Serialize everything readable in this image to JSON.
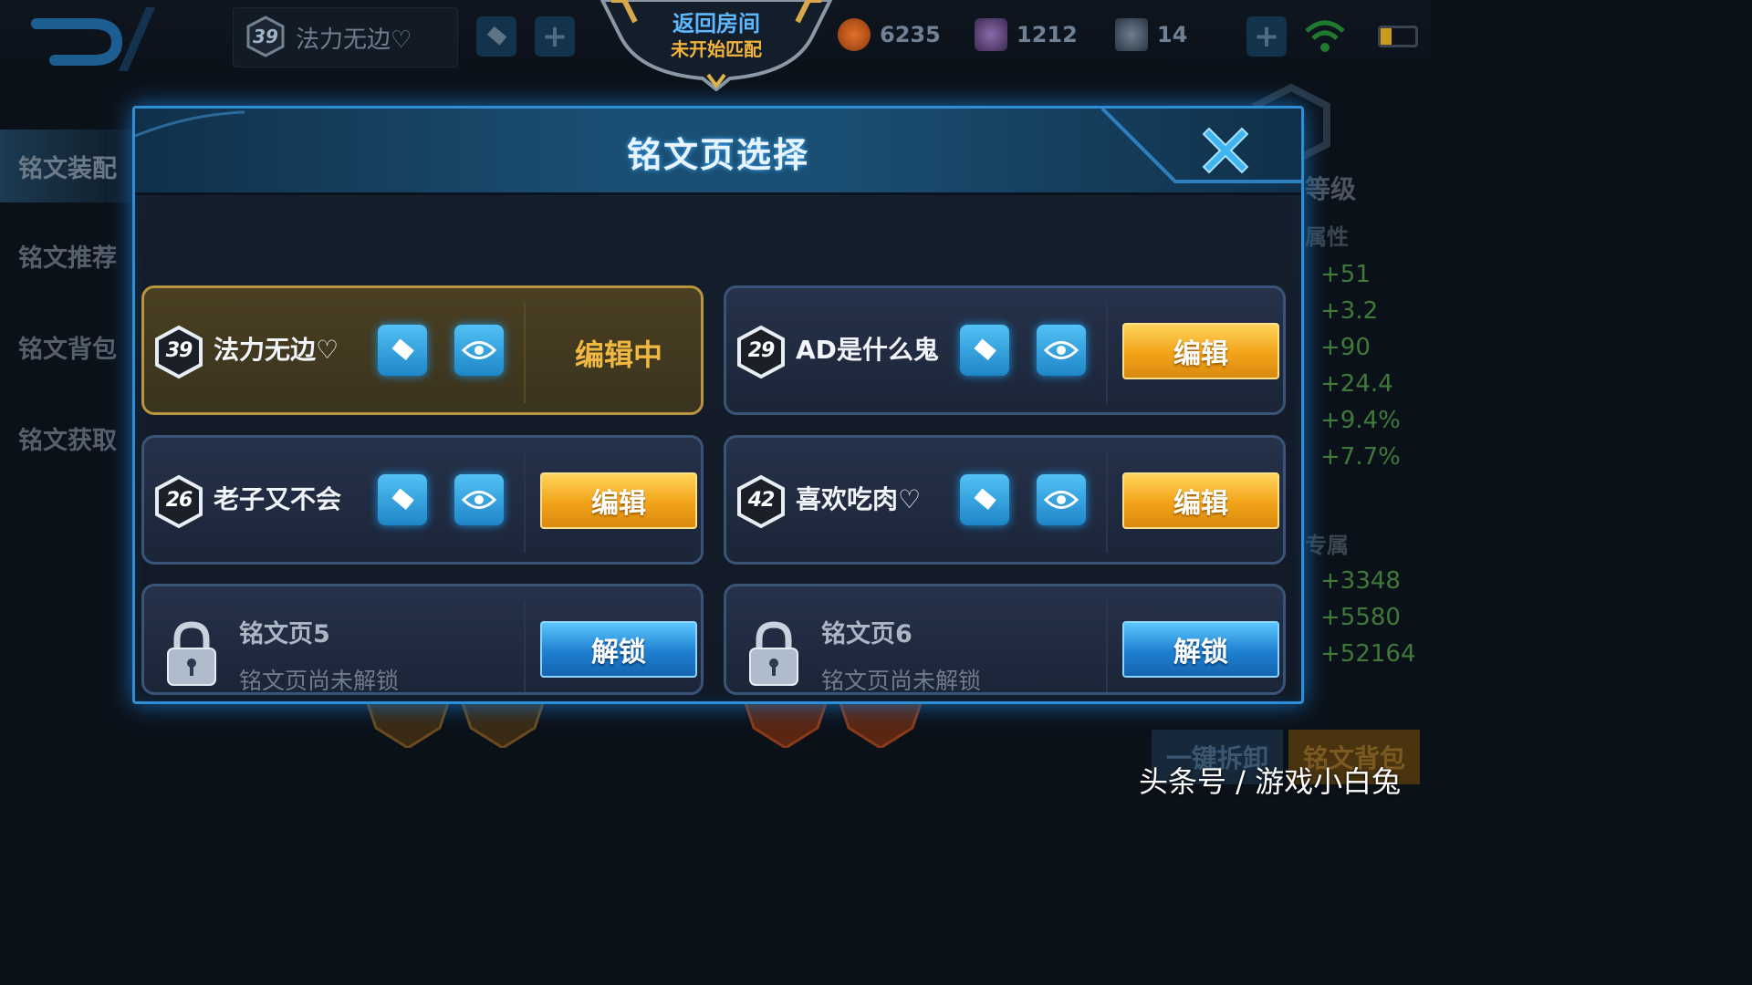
{
  "topbar": {
    "player_level": "39",
    "player_page_name": "法力无边♡",
    "room": {
      "title": "返回房间",
      "subtitle": "未开始匹配"
    },
    "resources": {
      "gold": "6235",
      "diamonds": "1212",
      "vouchers": "14"
    }
  },
  "sidebar": {
    "items": [
      {
        "label": "铭文装配"
      },
      {
        "label": "铭文推荐"
      },
      {
        "label": "铭文背包"
      },
      {
        "label": "铭文获取"
      }
    ]
  },
  "right_panel": {
    "level_label": "等级",
    "attr_label": "属性",
    "stats": [
      "+51",
      "+3.2",
      "+90",
      "+24.4",
      "+9.4%",
      "+7.7%"
    ],
    "exclusive_label": "专属",
    "exclusive_stats": [
      "+3348",
      "+5580",
      "+52164"
    ]
  },
  "bottom_buttons": {
    "disassemble": "一键拆卸",
    "bag": "铭文背包"
  },
  "modal": {
    "title": "铭文页选择",
    "pages": [
      {
        "level": "39",
        "name": "法力无边♡",
        "state": "编辑中"
      },
      {
        "level": "29",
        "name": "AD是什么鬼",
        "action": "编辑"
      },
      {
        "level": "26",
        "name": "老子又不会",
        "action": "编辑"
      },
      {
        "level": "42",
        "name": "喜欢吃肉♡",
        "action": "编辑"
      }
    ],
    "locked_pages": [
      {
        "name": "铭文页5",
        "desc": "铭文页尚未解锁",
        "action": "解锁"
      },
      {
        "name": "铭文页6",
        "desc": "铭文页尚未解锁",
        "action": "解锁"
      }
    ]
  },
  "watermark": "头条号 / 游戏小白兔",
  "colors": {
    "accent_blue": "#2f8fd6",
    "gold": "#f2a318",
    "active_card": "#b8963e"
  }
}
